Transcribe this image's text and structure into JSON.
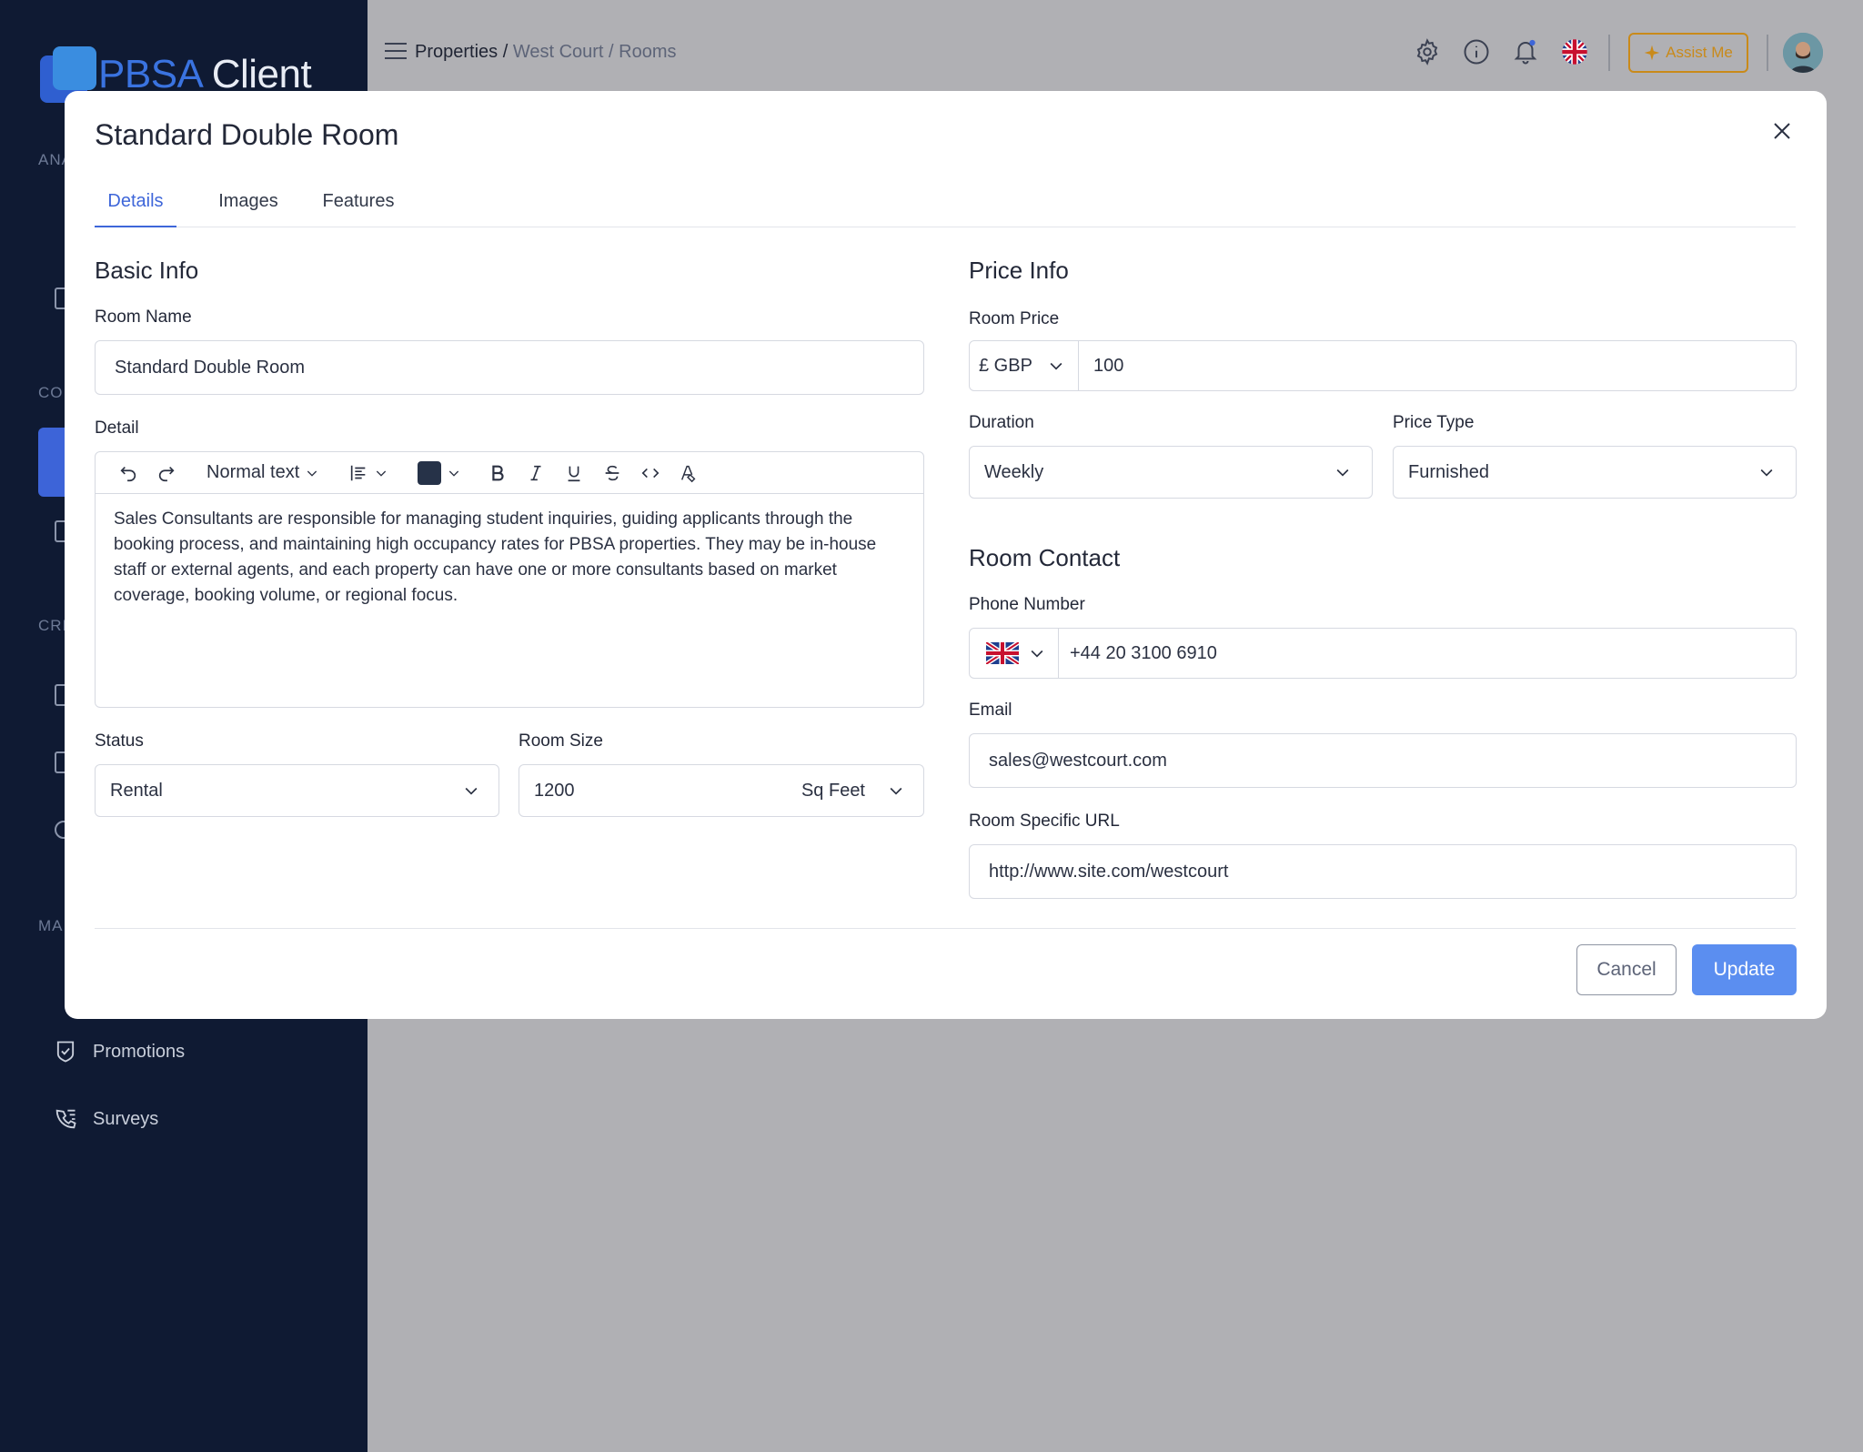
{
  "app": {
    "logo_part1": "PBSA",
    "logo_part2": "Client"
  },
  "sidebar": {
    "sections": [
      "ANA",
      "CO",
      "CRI",
      "MA"
    ],
    "items": [
      {
        "label": "Promotions",
        "icon": "shield-check-icon"
      },
      {
        "label": "Surveys",
        "icon": "phone-list-icon"
      }
    ]
  },
  "header": {
    "breadcrumb_root": "Properties /",
    "breadcrumb_rest": "West Court / Rooms",
    "assist_label": "Assist Me"
  },
  "modal": {
    "title": "Standard Double Room",
    "tabs": [
      "Details",
      "Images",
      "Features"
    ],
    "active_tab": "Details",
    "basic_info": {
      "title": "Basic Info",
      "room_name_label": "Room Name",
      "room_name_value": "Standard Double Room",
      "detail_label": "Detail",
      "text_style": "Normal text",
      "detail_text": "Sales Consultants are responsible for managing student inquiries, guiding applicants through the booking process, and maintaining high occupancy rates for PBSA properties. They may be in-house staff or external agents, and each property can have one or more consultants based on market coverage, booking volume, or regional focus.",
      "status_label": "Status",
      "status_value": "Rental",
      "room_size_label": "Room Size",
      "room_size_value": "1200",
      "room_size_unit": "Sq Feet"
    },
    "price_info": {
      "title": "Price Info",
      "room_price_label": "Room Price",
      "currency": "£ GBP",
      "price_value": "100",
      "duration_label": "Duration",
      "duration_value": "Weekly",
      "price_type_label": "Price Type",
      "price_type_value": "Furnished"
    },
    "room_contact": {
      "title": "Room Contact",
      "phone_label": "Phone Number",
      "phone_value": "+44 20 3100 6910",
      "email_label": "Email",
      "email_value": "sales@westcourt.com",
      "url_label": "Room Specific URL",
      "url_value": "http://www.site.com/westcourt"
    },
    "buttons": {
      "cancel": "Cancel",
      "update": "Update"
    }
  },
  "colors": {
    "sidebar_bg": "#0f1a33",
    "accent": "#3e66d9",
    "update_button": "#5b8ef0",
    "assist": "#c98a1a",
    "overlay": "#b0b0b4"
  }
}
